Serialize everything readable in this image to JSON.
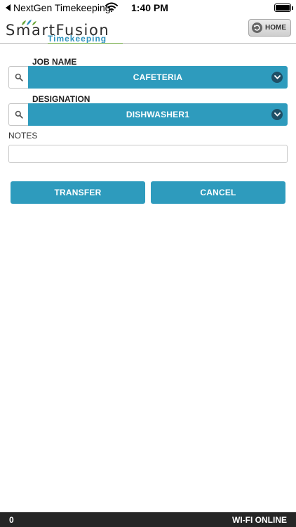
{
  "status_bar": {
    "back_app": "NextGen Timekeeping",
    "time": "1:40 PM"
  },
  "header": {
    "logo_main": "SmartFusion",
    "logo_sub": "Timekeeping",
    "home_label": "HOME"
  },
  "form": {
    "job_name_label": "JOB NAME",
    "job_name_value": "CAFETERIA",
    "designation_label": "DESIGNATION",
    "designation_value": "DISHWASHER1",
    "notes_label": "NOTES",
    "notes_value": ""
  },
  "actions": {
    "transfer_label": "TRANSFER",
    "cancel_label": "CANCEL"
  },
  "footer": {
    "count": "0",
    "connection": "WI-FI ONLINE"
  },
  "colors": {
    "accent": "#2e9bbd",
    "chevron_bg": "#1f4f66",
    "footer_bg": "#262626"
  },
  "icons": {
    "back": "back-arrow-icon",
    "wifi": "wifi-icon",
    "battery": "battery-icon",
    "home": "home-return-icon",
    "search": "search-icon",
    "chevron": "chevron-down-icon"
  }
}
